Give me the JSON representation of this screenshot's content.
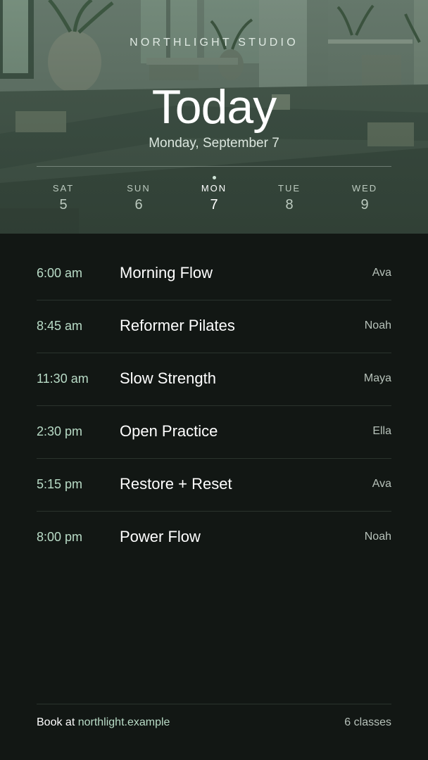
{
  "header": {
    "brand": "NORTHLIGHT STUDIO",
    "title": "Today",
    "date": "Monday, September 7"
  },
  "days": [
    {
      "dow": "SAT",
      "num": "5",
      "active": false
    },
    {
      "dow": "SUN",
      "num": "6",
      "active": false
    },
    {
      "dow": "MON",
      "num": "7",
      "active": true
    },
    {
      "dow": "TUE",
      "num": "8",
      "active": false
    },
    {
      "dow": "WED",
      "num": "9",
      "active": false
    }
  ],
  "classes": [
    {
      "time": "6:00 am",
      "name": "Morning Flow",
      "teacher": "Ava"
    },
    {
      "time": "8:45 am",
      "name": "Reformer Pilates",
      "teacher": "Noah"
    },
    {
      "time": "11:30 am",
      "name": "Slow Strength",
      "teacher": "Maya"
    },
    {
      "time": "2:30 pm",
      "name": "Open Practice",
      "teacher": "Ella"
    },
    {
      "time": "5:15 pm",
      "name": "Restore + Reset",
      "teacher": "Ava"
    },
    {
      "time": "8:00 pm",
      "name": "Power Flow",
      "teacher": "Noah"
    }
  ],
  "footer": {
    "book_prefix": "Book at ",
    "book_link": "northlight.example",
    "count": "6 classes"
  },
  "colors": {
    "background": "#121714",
    "accent": "#b9dcc7",
    "hero": "#4d6054"
  }
}
